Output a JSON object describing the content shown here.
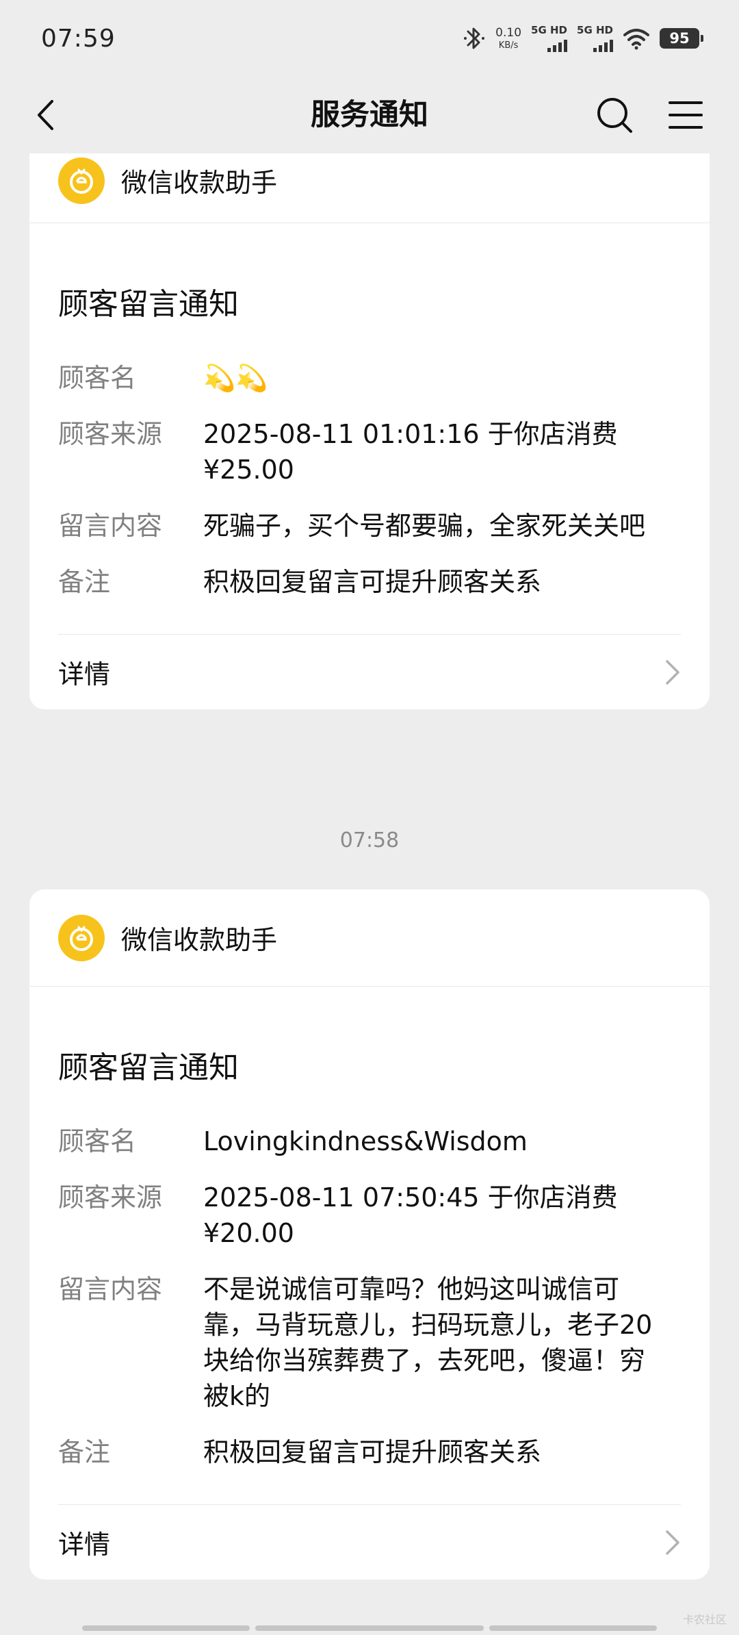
{
  "status_bar": {
    "time": "07:59",
    "net_speed_value": "0.10",
    "net_speed_unit": "KB/s",
    "signal_1_label": "5G HD",
    "signal_2_label": "5G HD",
    "battery": "95",
    "icons": [
      "bluetooth-icon",
      "wifi-icon",
      "battery-icon"
    ]
  },
  "nav": {
    "title": "服务通知",
    "icons": [
      "back-icon",
      "search-icon",
      "menu-icon"
    ]
  },
  "cards": [
    {
      "app_name": "微信收款助手",
      "title": "顾客留言通知",
      "rows": [
        {
          "key": "顾客名",
          "value": "💫💫"
        },
        {
          "key": "顾客来源",
          "value": "2025-08-11 01:01:16 于你店消费¥25.00"
        },
        {
          "key": "留言内容",
          "value": "死骗子，买个号都要骗，全家死关关吧"
        },
        {
          "key": "备注",
          "value": "积极回复留言可提升顾客关系"
        }
      ],
      "detail_label": "详情"
    },
    {
      "app_name": "微信收款助手",
      "title": "顾客留言通知",
      "rows": [
        {
          "key": "顾客名",
          "value": "Lovingkindness&Wisdom"
        },
        {
          "key": "顾客来源",
          "value": "2025-08-11 07:50:45 于你店消费¥20.00"
        },
        {
          "key": "留言内容",
          "value": "不是说诚信可靠吗？他妈这叫诚信可靠，马背玩意儿，扫码玩意儿，老子20块给你当殡葬费了，去死吧，傻逼！穷被k的"
        },
        {
          "key": "备注",
          "value": "积极回复留言可提升顾客关系"
        }
      ],
      "detail_label": "详情"
    }
  ],
  "timestamp": "07:58",
  "watermark": "卡农社区",
  "colors": {
    "background": "#ededed",
    "card": "#ffffff",
    "logo": "#f7c21b",
    "label_gray": "#808080"
  }
}
